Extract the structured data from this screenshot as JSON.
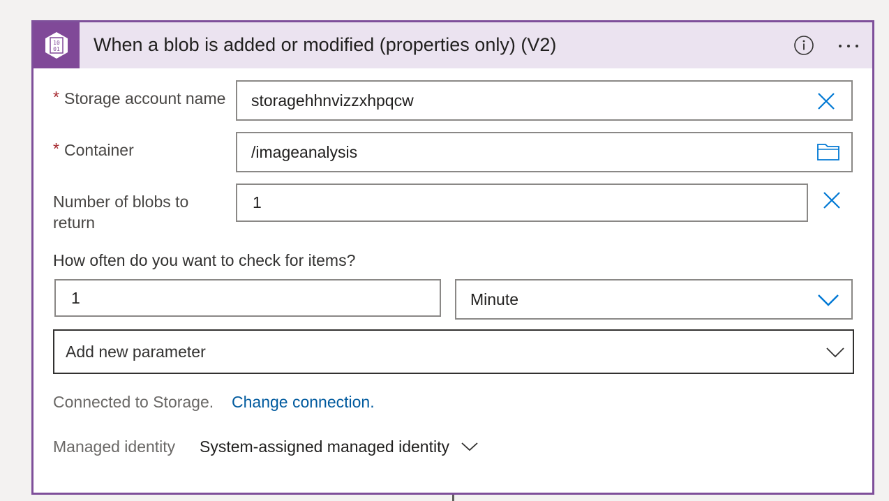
{
  "header": {
    "title": "When a blob is added or modified (properties only) (V2)",
    "icon": "blob-storage-icon",
    "accent": "#804998",
    "border_color": "#7e4f9a",
    "header_bg": "#ebe3f0"
  },
  "fields": {
    "storage_account": {
      "label": "Storage account name",
      "required_mark": "*",
      "value": "storagehhnvizzxhpqcw"
    },
    "container": {
      "label": "Container",
      "required_mark": "*",
      "value": "/imageanalysis"
    },
    "num_blobs": {
      "label_line1": "Number of blobs to",
      "label_line2": "return",
      "value": "1"
    }
  },
  "recurrence": {
    "label": "How often do you want to check for items?",
    "interval": "1",
    "frequency": "Minute"
  },
  "add_parameter": {
    "label": "Add new parameter"
  },
  "connection": {
    "status": "Connected to Storage.",
    "change_link": "Change connection."
  },
  "managed_identity": {
    "label": "Managed identity",
    "value": "System-assigned managed identity"
  }
}
